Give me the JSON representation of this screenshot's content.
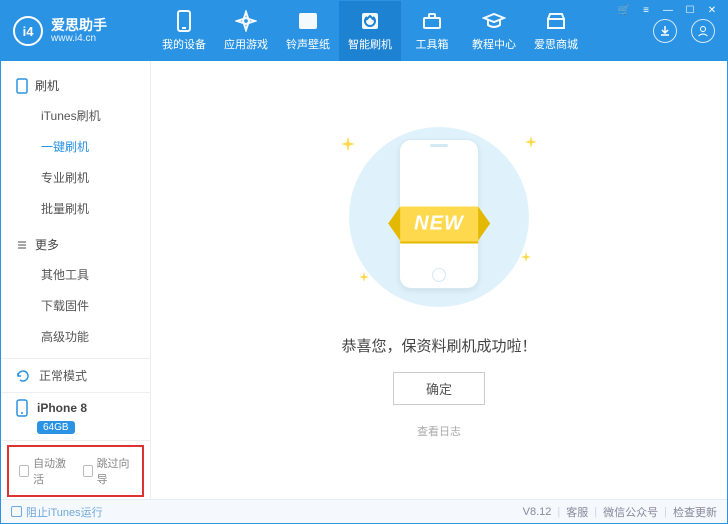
{
  "brand": {
    "name": "爱思助手",
    "url": "www.i4.cn",
    "logo_text": "i4"
  },
  "tabs": [
    {
      "label": "我的设备"
    },
    {
      "label": "应用游戏"
    },
    {
      "label": "铃声壁纸"
    },
    {
      "label": "智能刷机"
    },
    {
      "label": "工具箱"
    },
    {
      "label": "教程中心"
    },
    {
      "label": "爱思商城"
    }
  ],
  "sidebar": {
    "section1": {
      "title": "刷机",
      "items": [
        "iTunes刷机",
        "一键刷机",
        "专业刷机",
        "批量刷机"
      ]
    },
    "section2": {
      "title": "更多",
      "items": [
        "其他工具",
        "下载固件",
        "高级功能"
      ]
    }
  },
  "mode": {
    "label": "正常模式"
  },
  "device": {
    "name": "iPhone 8",
    "capacity": "64GB"
  },
  "checks": {
    "auto_activate": "自动激活",
    "skip_guide": "跳过向导"
  },
  "main": {
    "ribbon": "NEW",
    "message": "恭喜您，保资料刷机成功啦！",
    "ok": "确定",
    "view_log": "查看日志"
  },
  "footer": {
    "block_itunes": "阻止iTunes运行",
    "version": "V8.12",
    "support": "客服",
    "wechat": "微信公众号",
    "update": "检查更新"
  }
}
